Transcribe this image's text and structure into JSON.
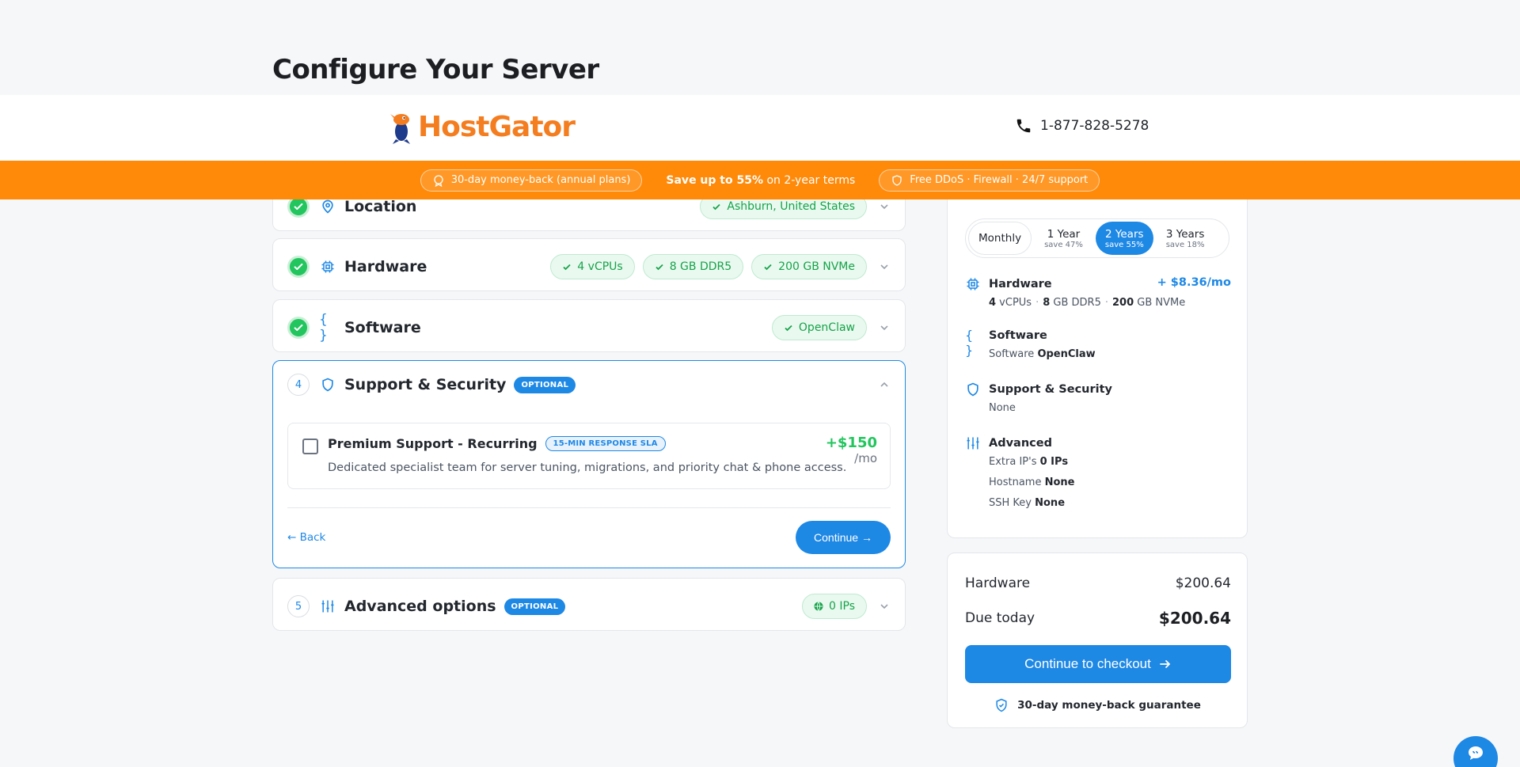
{
  "page": {
    "title": "Configure Your Server"
  },
  "header": {
    "logo_text": "HostGator",
    "phone": "1-877-828-5278"
  },
  "promo": {
    "left": "30-day money-back (annual plans)",
    "mid_bold": "Save up to 55%",
    "mid_rest": " on 2-year terms",
    "right": "Free DDoS · Firewall · 24/7 support"
  },
  "sections": {
    "location": {
      "title": "Location",
      "tag": "Ashburn, United States"
    },
    "hardware": {
      "title": "Hardware",
      "tags": [
        "4 vCPUs",
        "8 GB DDR5",
        "200 GB NVMe"
      ]
    },
    "software": {
      "title": "Software",
      "tag": "OpenClaw"
    },
    "support": {
      "number": "4",
      "title": "Support & Security",
      "badge": "OPTIONAL",
      "item": {
        "title": "Premium Support - Recurring",
        "sla": "15-MIN RESPONSE SLA",
        "desc": "Dedicated specialist team for server tuning, migrations, and priority chat & phone access.",
        "price": "+$150",
        "per": "/mo",
        "checked": false
      },
      "back": "← Back",
      "continue": "Continue →"
    },
    "advanced": {
      "number": "5",
      "title": "Advanced options",
      "badge": "OPTIONAL",
      "tag": "0 IPs"
    }
  },
  "summary": {
    "terms": [
      {
        "label": "Monthly",
        "save": ""
      },
      {
        "label": "1 Year",
        "save": "save 47%"
      },
      {
        "label": "2 Years",
        "save": "save 55%",
        "selected": true
      },
      {
        "label": "3 Years",
        "save": "save 18%"
      }
    ],
    "hardware": {
      "title": "Hardware",
      "price": "+ $8.36/mo",
      "cpu_n": "4",
      "cpu_u": " vCPUs",
      "ram_n": "8",
      "ram_u": " GB DDR5",
      "disk_n": "200",
      "disk_u": " GB NVMe"
    },
    "software": {
      "title": "Software",
      "label": "Software",
      "value": "OpenClaw"
    },
    "support": {
      "title": "Support & Security",
      "value": "None"
    },
    "advanced": {
      "title": "Advanced",
      "ips_label": "Extra IP's",
      "ips_value": "0 IPs",
      "host_label": "Hostname",
      "host_value": "None",
      "ssh_label": "SSH Key",
      "ssh_value": "None"
    }
  },
  "totals": {
    "hardware_label": "Hardware",
    "hardware_value": "$200.64",
    "due_label": "Due today",
    "due_value": "$200.64",
    "checkout": "Continue to checkout",
    "guarantee": "30-day money-back guarantee"
  },
  "colors": {
    "accent": "#1e88e5",
    "brand": "#f47d20",
    "promo": "#ff8a0a",
    "success": "#22c55e"
  }
}
